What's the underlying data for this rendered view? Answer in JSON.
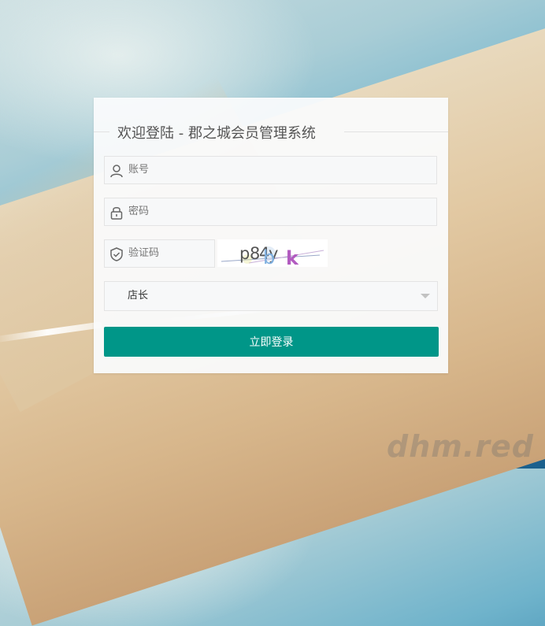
{
  "page": {
    "title": "欢迎登陆 - 郡之城会员管理系统",
    "watermark": "dhm.red"
  },
  "form": {
    "account": {
      "placeholder": "账号",
      "icon": "user-icon"
    },
    "password": {
      "placeholder": "密码",
      "icon": "lock-icon"
    },
    "captcha": {
      "placeholder": "验证码",
      "icon": "shield-icon",
      "image_text": [
        "p",
        "8",
        "4",
        "y",
        "b",
        "k"
      ]
    },
    "role": {
      "selected": "店长"
    },
    "login_label": "立即登录"
  },
  "colors": {
    "accent": "#009688",
    "captcha_letters": [
      "#555555",
      "#555555",
      "#555555",
      "#555555",
      "#7fb0e0",
      "#b25cc0"
    ]
  }
}
